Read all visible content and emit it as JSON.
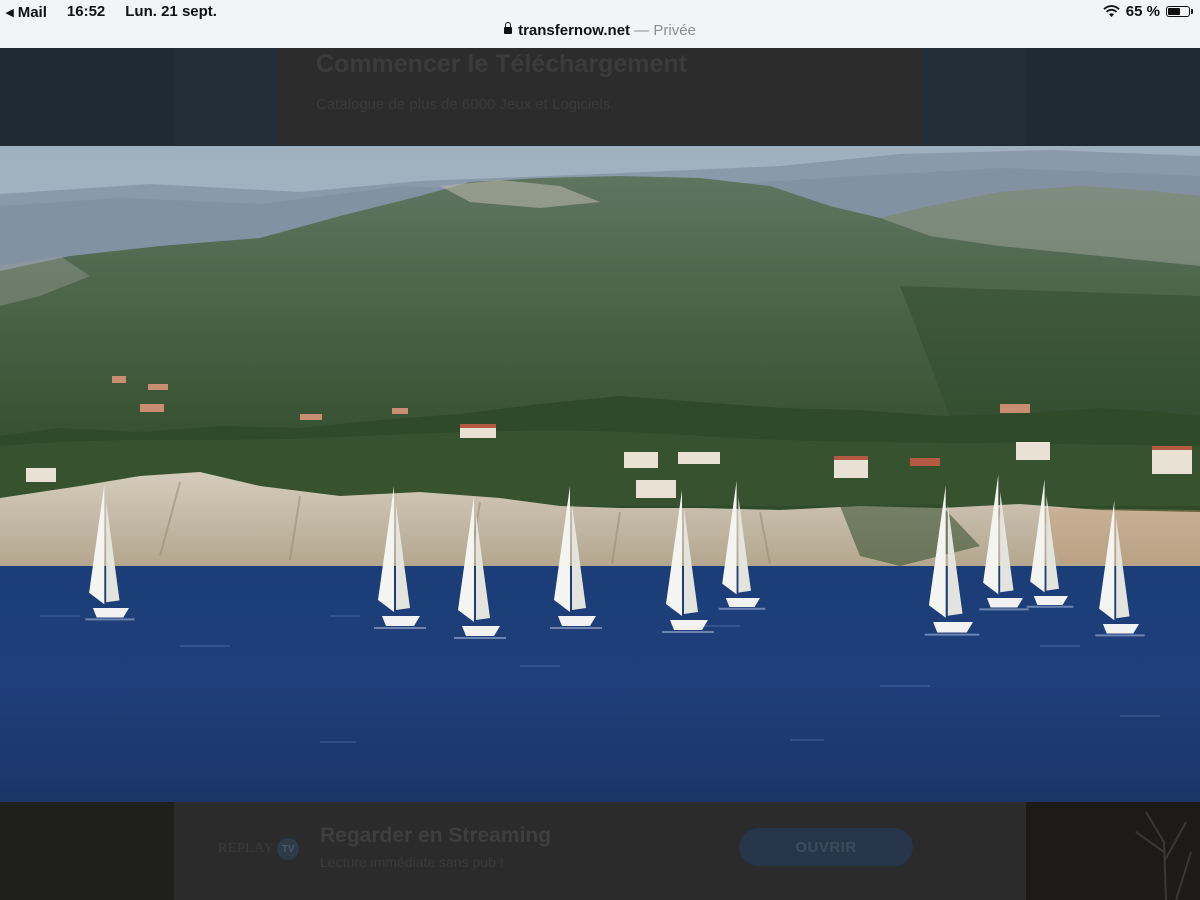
{
  "status_bar": {
    "back_app": "Mail",
    "time": "16:52",
    "date": "Lun. 21 sept.",
    "battery": "65 %",
    "battery_level": 0.65
  },
  "address": {
    "host": "transfernow.net",
    "mode": "— Privée"
  },
  "top_banner": {
    "title": "Commencer le Téléchargement",
    "subtitle": "Catalogue de plus de 6000 Jeux et Logiciels."
  },
  "photo": {
    "alt_icon": "image-icon"
  },
  "bottom_ad": {
    "logo_text": "REPLAY",
    "logo_badge": "TV",
    "title": "Regarder en Streaming",
    "subtitle": "Lecture immédiate sans pub !",
    "button_label": "OUVRIR"
  },
  "colors": {
    "sea": "#1f3f7a",
    "hills": "#3d5c3a",
    "cliff": "#c9c0ad"
  }
}
